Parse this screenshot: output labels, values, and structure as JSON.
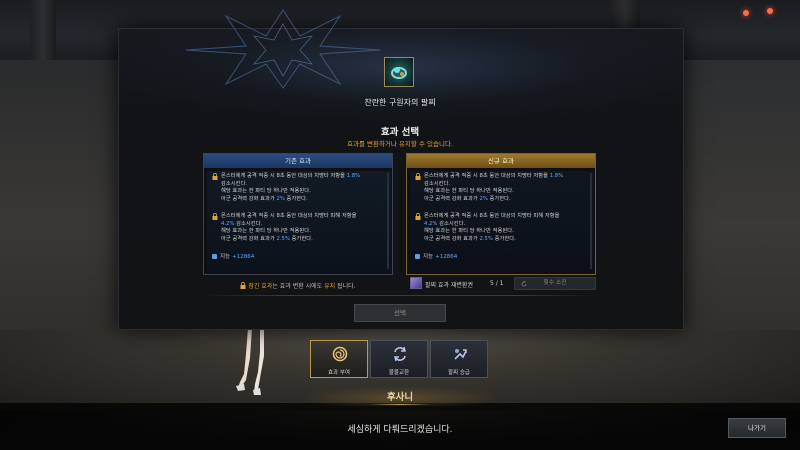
{
  "item": {
    "name": "찬란한 구원자의 팔찌",
    "icon": "bracelet-icon"
  },
  "dialog": {
    "title": "효과 선택",
    "subtitle": "효과를 변환하거나 유지할 수 있습니다."
  },
  "current_panel": {
    "header": "기존 효과",
    "effects": [
      {
        "lines": [
          {
            "pre": "몬스터에게 공격 적중 시 8초 동안 대상의 치명타 저항을 ",
            "val": "1.8%"
          },
          {
            "pre": "감소시킨다."
          },
          {
            "pre": "해당 효과는 한 파티 당 하나만 적용된다."
          },
          {
            "pre": "아군 공격력 강화 효과가 ",
            "val": "2%",
            "post": " 증가한다."
          }
        ]
      },
      {
        "lines": [
          {
            "pre": "몬스터에게 공격 적중 시 8초 동안 대상의 치명타 피해 저항을"
          },
          {
            "pre": "",
            "val": "4.2%",
            "post": " 감소시킨다."
          },
          {
            "pre": "해당 효과는 한 파티 당 하나만 적용된다."
          },
          {
            "pre": "아군 공격력 강화 효과가 ",
            "val": "2.5%",
            "post": " 증가한다."
          }
        ]
      }
    ],
    "stat": {
      "label": "지능",
      "value": "+12864"
    }
  },
  "new_panel": {
    "header": "신규 효과",
    "effects": [
      {
        "lines": [
          {
            "pre": "몬스터에게 공격 적중 시 8초 동안 대상의 치명타 저항을 ",
            "val": "1.8%"
          },
          {
            "pre": "감소시킨다."
          },
          {
            "pre": "해당 효과는 한 파티 당 하나만 적용된다."
          },
          {
            "pre": "아군 공격력 강화 효과가 ",
            "val": "2%",
            "post": " 증가한다."
          }
        ]
      },
      {
        "lines": [
          {
            "pre": "몬스터에게 공격 적중 시 8초 동안 대상의 치명타 피해 저항을"
          },
          {
            "pre": "",
            "val": "4.2%",
            "post": " 감소시킨다."
          },
          {
            "pre": "해당 효과는 한 파티 당 하나만 적용된다."
          },
          {
            "pre": "아군 공격력 강화 효과가 ",
            "val": "2.5%",
            "post": " 증가한다."
          }
        ]
      }
    ],
    "stat": {
      "label": "지능",
      "value": "+12864"
    }
  },
  "note": {
    "pre": " 잠긴 효과",
    "mid": "는 효과 변환 시에도 ",
    "gold": "유지",
    "post": " 됩니다."
  },
  "cost": {
    "label": "팔찌 효과 재변환권",
    "count": "5 / 1",
    "button": "횟수 소진"
  },
  "select_button": "선택",
  "tools": [
    {
      "label": "효과 부여",
      "icon": "swirl-icon",
      "active": true
    },
    {
      "label": "물물교환",
      "icon": "exchange-icon",
      "active": false
    },
    {
      "label": "팔찌 승급",
      "icon": "upgrade-icon",
      "active": false
    }
  ],
  "npc": {
    "name": "후사니",
    "text": "세심하게 다뤄드리겠습니다."
  },
  "exit_button": "나가기",
  "colors": {
    "accent_gold": "#e0a33a",
    "highlight_blue": "#5fa8ff",
    "current_header": "#2c4c80",
    "new_header": "#a0782c"
  }
}
